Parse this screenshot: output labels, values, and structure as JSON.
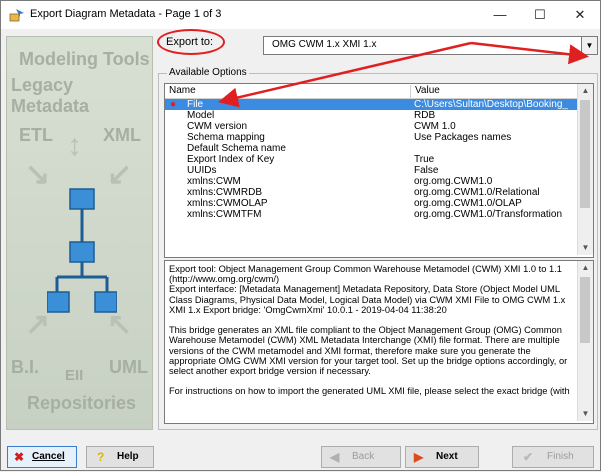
{
  "window": {
    "title": "Export Diagram Metadata - Page 1 of 3",
    "minimize": "—",
    "maximize": "☐",
    "close": "✕"
  },
  "banner": {
    "modeling_tools": "Modeling Tools",
    "legacy_metadata": "Legacy Metadata",
    "etl": "ETL",
    "xml": "XML",
    "bi": "B.I.",
    "uml": "UML",
    "eii": "EII",
    "repositories": "Repositories"
  },
  "export": {
    "label": "Export to:",
    "selected": "OMG CWM 1.x XMI 1.x"
  },
  "options": {
    "group_title": "Available Options",
    "col_name": "Name",
    "col_value": "Value",
    "rows": [
      {
        "name": "File",
        "value": "C:\\Users\\Sultan\\Desktop\\Booking_"
      },
      {
        "name": "Model",
        "value": "RDB"
      },
      {
        "name": "CWM version",
        "value": "CWM 1.0"
      },
      {
        "name": "Schema mapping",
        "value": "Use Packages names"
      },
      {
        "name": "Default Schema name",
        "value": ""
      },
      {
        "name": "Export Index of Key",
        "value": "True"
      },
      {
        "name": "UUIDs",
        "value": "False"
      },
      {
        "name": "xmlns:CWM",
        "value": "org.omg.CWM1.0"
      },
      {
        "name": "xmlns:CWMRDB",
        "value": "org.omg.CWM1.0/Relational"
      },
      {
        "name": "xmlns:CWMOLAP",
        "value": "org.omg.CWM1.0/OLAP"
      },
      {
        "name": "xmlns:CWMTFM",
        "value": "org.omg.CWM1.0/Transformation"
      }
    ]
  },
  "description": "Export tool: Object Management Group Common Warehouse Metamodel (CWM) XMI 1.0 to 1.1\n(http://www.omg.org/cwm/)\nExport interface: [Metadata Management] Metadata Repository, Data Store (Object Model UML Class Diagrams, Physical Data Model, Logical Data Model) via CWM XMI File to OMG CWM 1.x XMI 1.x Export bridge: 'OmgCwmXmi' 10.0.1 - 2019-04-04 11:38:20\n\nThis bridge generates an XML file compliant to the Object Management Group (OMG) Common Warehouse Metamodel (CWM) XML Metadata Interchange (XMI) file format. There are multiple versions of the CWM metamodel and XMI format, therefore make sure you generate the appropriate OMG CWM XMI version for your target tool. Set up the bridge options accordingly, or select another export bridge version if necessary.\n\nFor instructions on how to import the generated UML XMI file, please select the exact bridge (with",
  "buttons": {
    "cancel": "Cancel",
    "help": "Help",
    "back": "Back",
    "next": "Next",
    "finish": "Finish"
  },
  "colors": {
    "selection": "#3b8be0",
    "annotation": "#e02020",
    "banner": "#d3dccf"
  }
}
